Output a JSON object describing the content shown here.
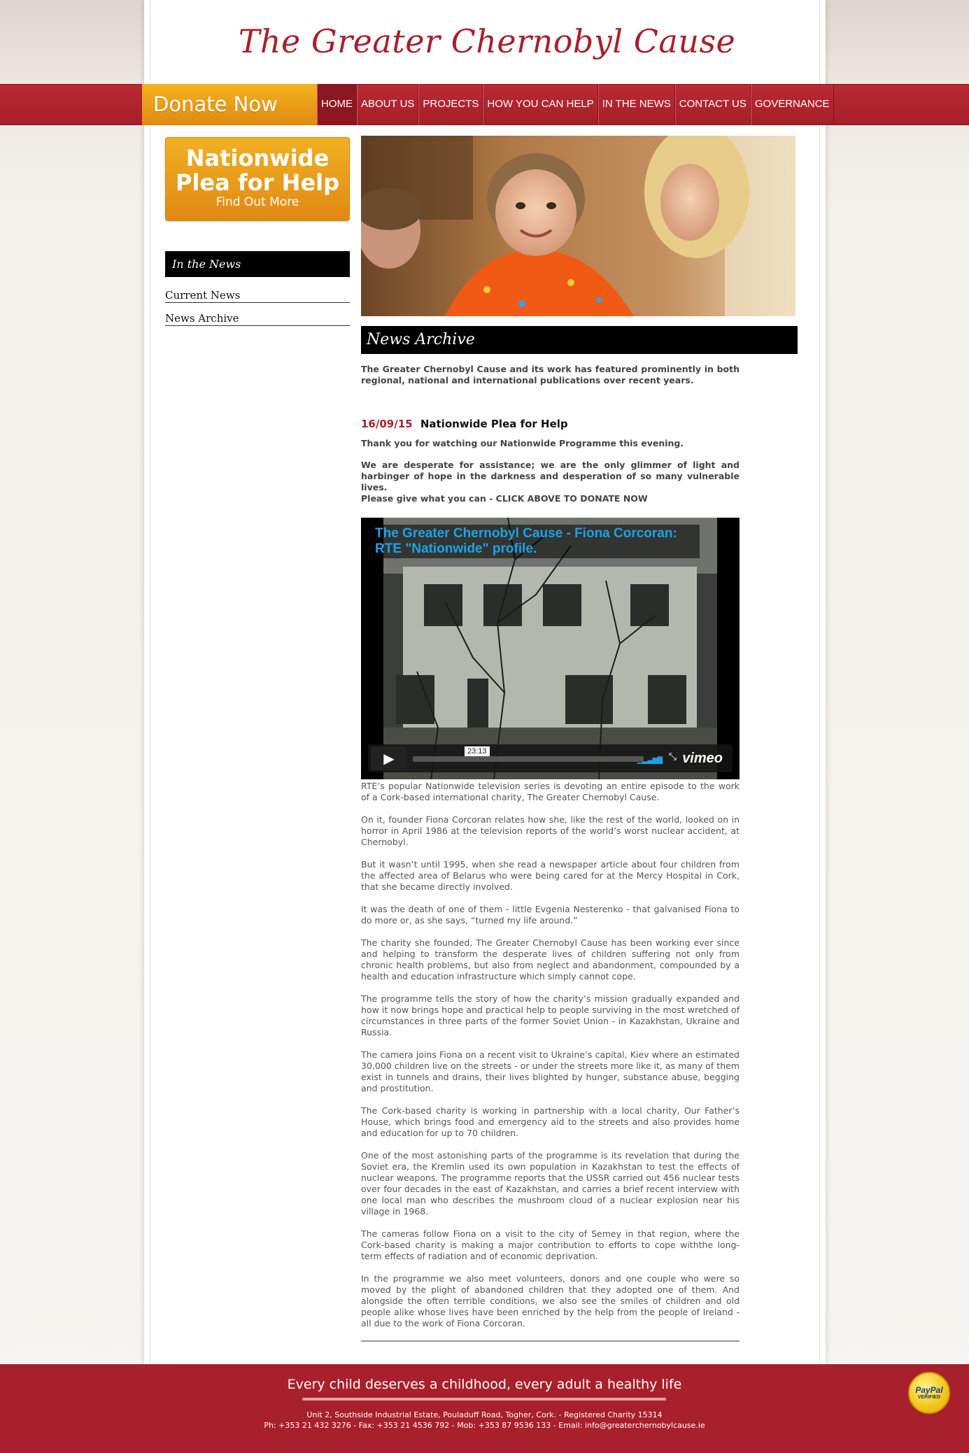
{
  "site": {
    "logo": "The Greater Chernobyl Cause"
  },
  "nav": {
    "donate": "Donate Now",
    "items": [
      {
        "label": "HOME"
      },
      {
        "label": "ABOUT US"
      },
      {
        "label": "PROJECTS"
      },
      {
        "label": "HOW YOU CAN HELP"
      },
      {
        "label": "IN THE NEWS"
      },
      {
        "label": "CONTACT US"
      },
      {
        "label": "GOVERNANCE"
      }
    ]
  },
  "sidebar": {
    "plea_title": "Nationwide Plea for Help",
    "plea_sub": "Find Out More",
    "heading": "In the News",
    "links": [
      {
        "label": "Current News"
      },
      {
        "label": "News Archive"
      }
    ]
  },
  "main": {
    "heading": "News Archive",
    "intro": "The Greater Chernobyl Cause and its work has featured prominently in both regional, national and international publications over recent years.",
    "news_date": "16/09/15",
    "news_title": "Nationwide Plea for Help",
    "para1": "Thank you for watching our Nationwide Programme this evening.",
    "para2": "We are desperate for assistance; we are the only glimmer of light and harbinger of hope in the darkness and desperation of so many vulnerable lives.",
    "para3": "Please give what you can - CLICK ABOVE TO DONATE NOW",
    "video": {
      "title": "The Greater Chernobyl Cause - Fiona Corcoran: RTE \"Nationwide\" profile.",
      "time": "23:13",
      "brand": "vimeo"
    },
    "body": [
      "RTE’s popular Nationwide television series is devoting an entire episode to the work of a Cork-based international charity, The Greater Chernobyl Cause.",
      "On it, founder Fiona Corcoran relates how she, like the rest of the world, looked on in horror in April 1986 at the television reports of the world’s worst nuclear accident, at Chernobyl.",
      "But it wasn’t until 1995, when she read a newspaper article about four children from the affected area of Belarus who were being cared for at the Mercy Hospital in Cork, that she became directly involved.",
      "It was the death of one of them - little Evgenia Nesterenko - that galvanised Fiona to do more or, as she says, “turned my life around.”",
      "The charity she founded, The Greater Chernobyl Cause has been working ever since and helping to transform the desperate lives of children suffering not only from chronic health problems, but also from neglect and abandonment, compounded by a health and education infrastructure which simply cannot cope.",
      "The programme tells the story of how the charity’s mission gradually expanded and how it now brings hope and practical help to people surviving in the most wretched of circumstances in three parts of the former Soviet Union - in Kazakhstan, Ukraine and Russia.",
      "The camera joins Fiona on a recent visit to Ukraine’s capital, Kiev where an estimated 30,000 children live on the streets - or under the streets more like it, as many of them exist in tunnels and drains, their lives blighted by hunger, substance abuse, begging and prostitution.",
      "The Cork-based charity is working in partnership with a local charity, Our Father’s House, which brings food and emergency aid to the streets and also provides home and education for up to 70 children.",
      "One of the most astonishing parts of the programme is its revelation that during the Soviet era, the Kremlin used its own population in Kazakhstan to test the effects of nuclear weapons. The programme reports that the USSR carried out 456 nuclear tests over four decades in the east of Kazakhstan, and carries a brief recent interview with one local man who describes the mushroom cloud of a nuclear explosion near his village in 1968.",
      "The cameras follow Fiona on a visit to the city of Semey in that region, where the Cork-based charity is making a major contribution to efforts to cope withthe long-term effects of radiation and of economic deprivation.",
      "In the programme we also meet volunteers, donors and one couple who were so moved by the plight of abandoned children that they adopted one of them. And alongside the often terrible conditions, we also see the smiles of children and old people alike whose lives have been enriched by the help from the people of Ireland - all due to the work of Fiona Corcoran."
    ]
  },
  "footer": {
    "tagline": "Every child deserves a childhood, every adult a healthy life",
    "address": "Unit 2, Southside Industrial Estate, Pouladuff Road, Togher, Cork. - Registered Charity 15314",
    "contact": "Ph: +353 21 432 3276 - Fax: +353 21 4536 792 - Mob: +353 87 9536 133 - Email: info@greaterchernobylcause.ie",
    "paypal_name": "PayPal",
    "paypal_verified": "VERIFIED"
  }
}
